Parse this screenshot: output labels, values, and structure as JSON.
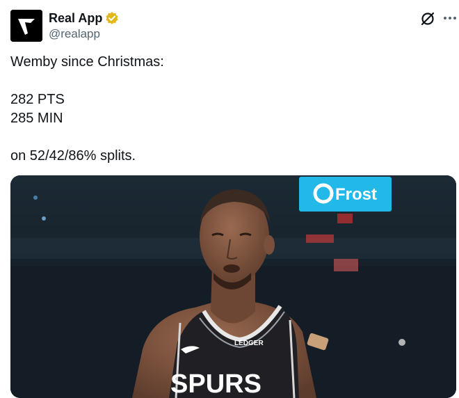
{
  "post": {
    "author": {
      "name": "Real App",
      "handle": "@realapp",
      "verified_badge_color": "#e2b719",
      "avatar_icon": "real-app-logo"
    },
    "text": "Wemby since Christmas:\n\n282 PTS\n285 MIN\n\non 52/42/86% splits.",
    "media": {
      "alt": "photo",
      "sign_text": "Frost",
      "jersey_text": "SPURS",
      "patch_text": "LEDGER"
    },
    "actions": {
      "grok_icon": "grok-icon",
      "more_icon": "more-icon"
    }
  }
}
